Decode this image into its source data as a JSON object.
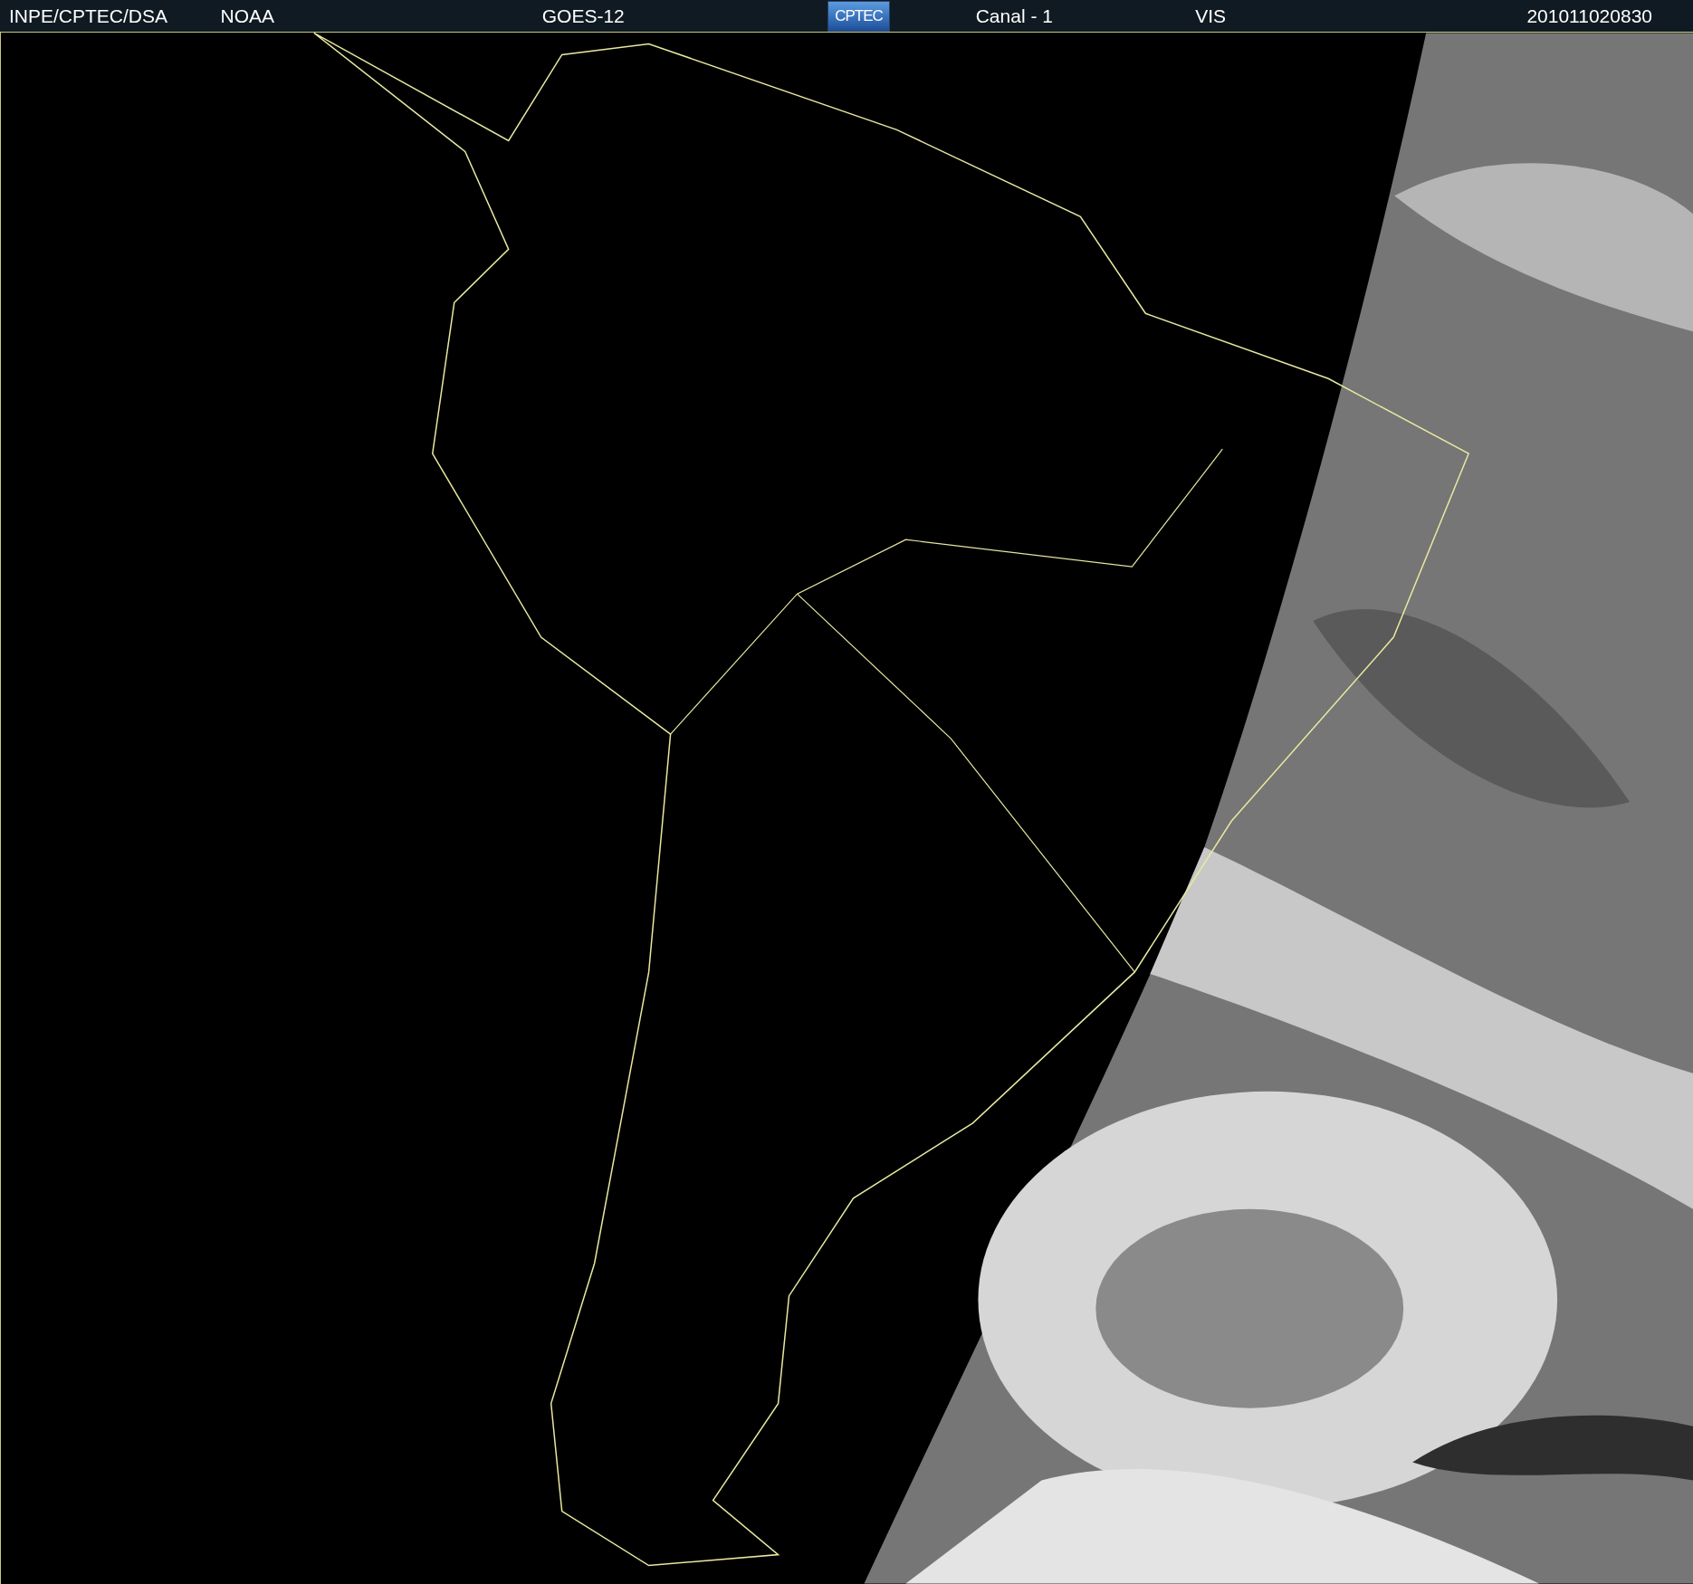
{
  "header": [
    {
      "kind": "text",
      "text": "INPE/CPTEC/DSA"
    },
    {
      "kind": "text",
      "text": "NOAA"
    },
    {
      "kind": "text",
      "text": "GOES-12"
    },
    {
      "kind": "logo",
      "text": "CPTEC"
    },
    {
      "kind": "text",
      "text": "Canal - 1"
    },
    {
      "kind": "text",
      "text": "VIS"
    },
    {
      "kind": "text",
      "text": "201011020830"
    }
  ]
}
